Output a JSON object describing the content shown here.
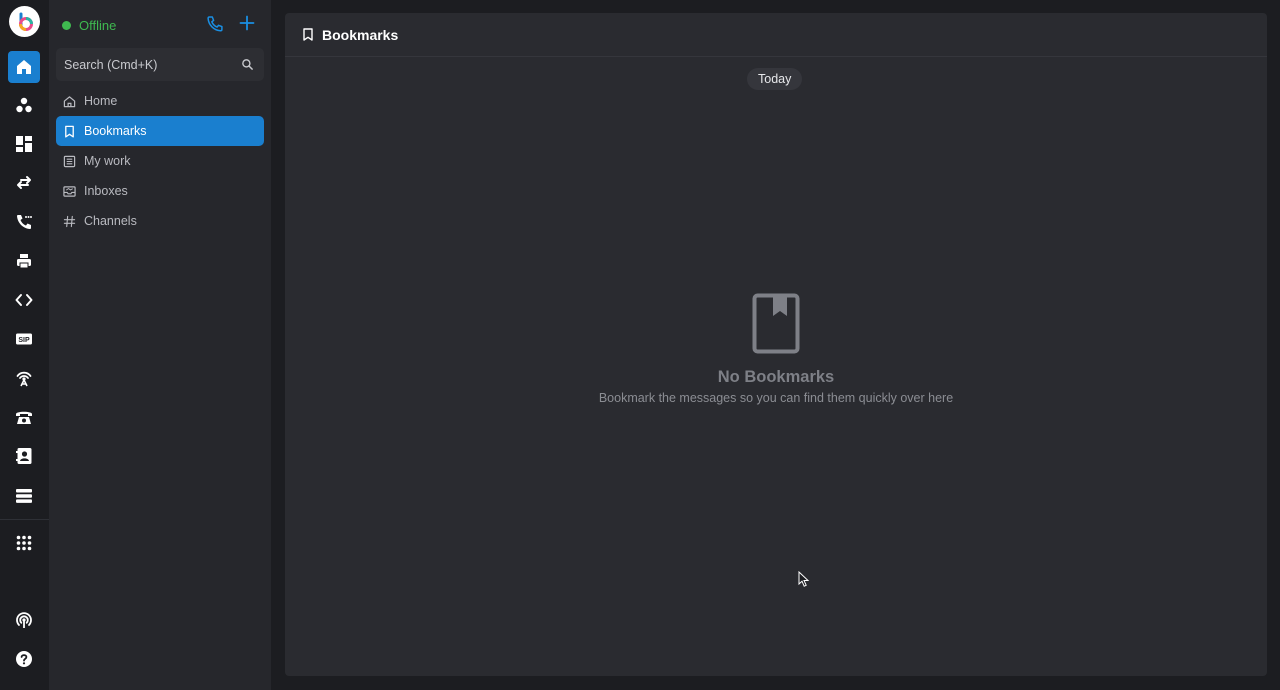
{
  "status": {
    "label": "Offline",
    "color": "#3fb950"
  },
  "search": {
    "placeholder": "Search (Cmd+K)"
  },
  "rail": {
    "items": [
      {
        "name": "home-icon",
        "active": true
      },
      {
        "name": "team-icon"
      },
      {
        "name": "dashboard-icon"
      },
      {
        "name": "transfer-icon"
      },
      {
        "name": "call-log-icon"
      },
      {
        "name": "printer-icon"
      },
      {
        "name": "code-icon"
      },
      {
        "name": "sip-icon",
        "text": "SIP"
      },
      {
        "name": "antenna-icon"
      },
      {
        "name": "desk-phone-icon"
      },
      {
        "name": "contacts-icon"
      },
      {
        "name": "server-icon"
      },
      {
        "name": "apps-grid-icon"
      },
      {
        "name": "broadcast-icon"
      },
      {
        "name": "help-icon"
      }
    ]
  },
  "nav": {
    "items": [
      {
        "label": "Home",
        "icon": "home-icon"
      },
      {
        "label": "Bookmarks",
        "icon": "bookmark-icon",
        "active": true
      },
      {
        "label": "My work",
        "icon": "list-icon"
      },
      {
        "label": "Inboxes",
        "icon": "inbox-icon"
      },
      {
        "label": "Channels",
        "icon": "hash-icon"
      }
    ]
  },
  "main": {
    "title": "Bookmarks",
    "date_chip": "Today",
    "empty_title": "No Bookmarks",
    "empty_subtitle": "Bookmark the messages so you can find them quickly over here"
  },
  "colors": {
    "accent": "#1a7fcf",
    "background": "#1c1d21",
    "panel": "#2a2b30",
    "sidebar": "#26272c"
  }
}
